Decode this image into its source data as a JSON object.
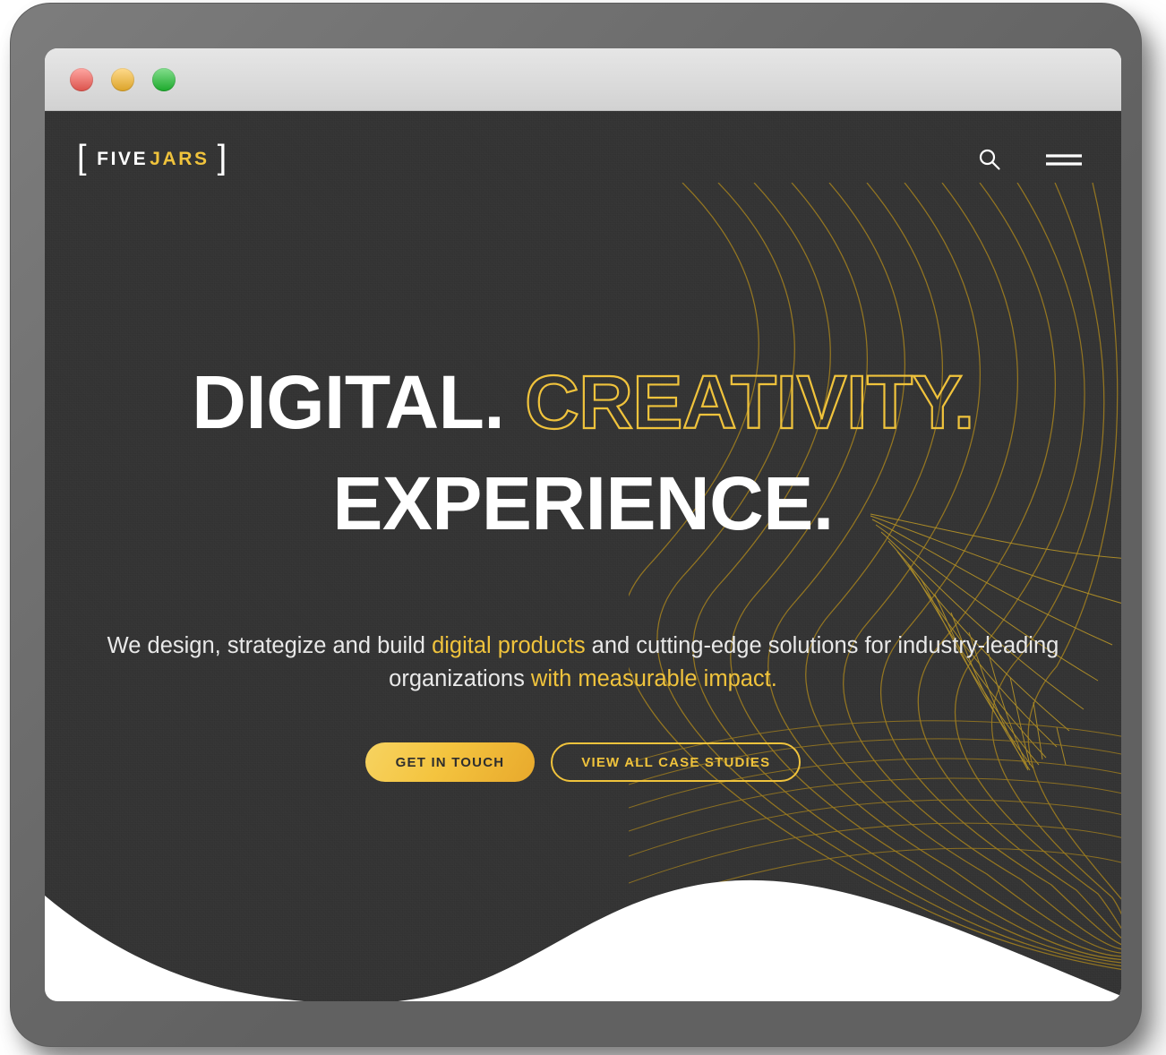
{
  "window": {
    "traffic_lights": [
      {
        "name": "close",
        "color": "#ff5f57"
      },
      {
        "name": "minimize",
        "color": "#ffbd2e"
      },
      {
        "name": "maximize",
        "color": "#1fc431"
      }
    ]
  },
  "theme": {
    "background": "#333333",
    "accent_yellow": "#f0c33c",
    "text_white": "#ffffff",
    "artwork_gold": "#9a7a20",
    "button_gradient_from": "#f7d361",
    "button_gradient_to": "#e8a92c",
    "title_bar": "#d8d8d8",
    "bezel": "#6e6e6e"
  },
  "navbar": {
    "logo": {
      "bracket_left": "[",
      "five": "FIVE",
      "jars": "JARS",
      "bracket_right": "]"
    },
    "search_icon": "search-icon",
    "menu_icon": "hamburger-menu-icon"
  },
  "hero": {
    "headline": {
      "line1_solid": "DIGITAL.",
      "line1_outline": "CREATIVITY.",
      "line2_solid": "EXPERIENCE."
    },
    "subtitle": {
      "part1": "We design, strategize and build ",
      "accent1": "digital products",
      "part2": " and cutting-edge solutions for industry-leading organizations ",
      "accent2": "with measurable impact."
    },
    "buttons": {
      "primary": "GET IN TOUCH",
      "secondary": "VIEW ALL CASE STUDIES"
    }
  }
}
